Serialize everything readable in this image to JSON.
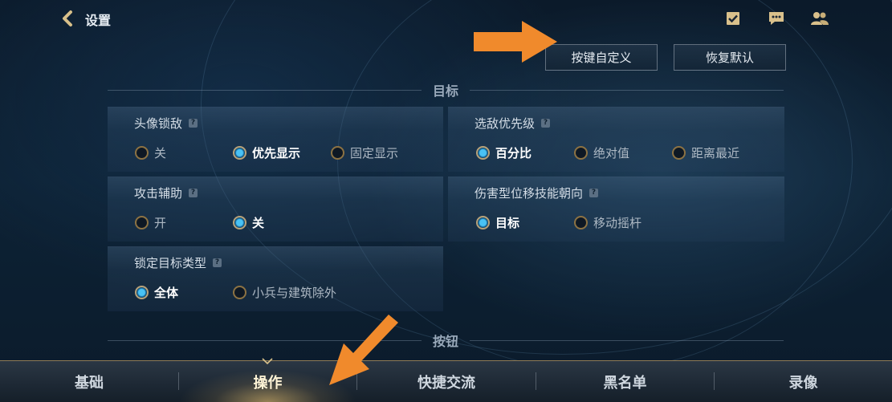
{
  "header": {
    "title": "设置",
    "buttons": {
      "custom_keys": "按键自定义",
      "restore_default": "恢复默认"
    }
  },
  "sections": {
    "target": "目标",
    "buttons": "按钮"
  },
  "settings": {
    "avatar_lock": {
      "title": "头像锁敌",
      "options": [
        "关",
        "优先显示",
        "固定显示"
      ],
      "selected": "优先显示"
    },
    "enemy_priority": {
      "title": "选敌优先级",
      "options": [
        "百分比",
        "绝对值",
        "距离最近"
      ],
      "selected": "百分比"
    },
    "attack_assist": {
      "title": "攻击辅助",
      "options": [
        "开",
        "关"
      ],
      "selected": "关"
    },
    "damage_skill_direction": {
      "title": "伤害型位移技能朝向",
      "options": [
        "目标",
        "移动摇杆"
      ],
      "selected": "目标"
    },
    "lock_target_type": {
      "title": "锁定目标类型",
      "options": [
        "全体",
        "小兵与建筑除外"
      ],
      "selected": "全体"
    }
  },
  "tabs": [
    {
      "label": "基础",
      "active": false
    },
    {
      "label": "操作",
      "active": true
    },
    {
      "label": "快捷交流",
      "active": false
    },
    {
      "label": "黑名单",
      "active": false
    },
    {
      "label": "录像",
      "active": false
    }
  ],
  "help_mark": "?",
  "colors": {
    "accent": "#f08a2c",
    "gold": "#8c7243",
    "radio_active": "#49c2f4"
  },
  "icons": [
    "back-chevron-icon",
    "checklist-icon",
    "chat-bubble-icon",
    "friends-icon",
    "help-icon"
  ]
}
